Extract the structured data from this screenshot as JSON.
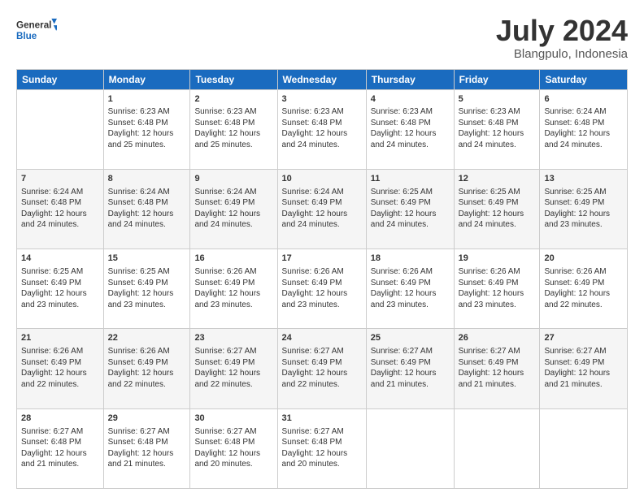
{
  "logo": {
    "line1": "General",
    "line2": "Blue"
  },
  "title": "July 2024",
  "subtitle": "Blangpulo, Indonesia",
  "days_header": [
    "Sunday",
    "Monday",
    "Tuesday",
    "Wednesday",
    "Thursday",
    "Friday",
    "Saturday"
  ],
  "weeks": [
    [
      {
        "day": "",
        "info": ""
      },
      {
        "day": "1",
        "info": "Sunrise: 6:23 AM\nSunset: 6:48 PM\nDaylight: 12 hours\nand 25 minutes."
      },
      {
        "day": "2",
        "info": "Sunrise: 6:23 AM\nSunset: 6:48 PM\nDaylight: 12 hours\nand 25 minutes."
      },
      {
        "day": "3",
        "info": "Sunrise: 6:23 AM\nSunset: 6:48 PM\nDaylight: 12 hours\nand 24 minutes."
      },
      {
        "day": "4",
        "info": "Sunrise: 6:23 AM\nSunset: 6:48 PM\nDaylight: 12 hours\nand 24 minutes."
      },
      {
        "day": "5",
        "info": "Sunrise: 6:23 AM\nSunset: 6:48 PM\nDaylight: 12 hours\nand 24 minutes."
      },
      {
        "day": "6",
        "info": "Sunrise: 6:24 AM\nSunset: 6:48 PM\nDaylight: 12 hours\nand 24 minutes."
      }
    ],
    [
      {
        "day": "7",
        "info": ""
      },
      {
        "day": "8",
        "info": "Sunrise: 6:24 AM\nSunset: 6:48 PM\nDaylight: 12 hours\nand 24 minutes."
      },
      {
        "day": "9",
        "info": "Sunrise: 6:24 AM\nSunset: 6:49 PM\nDaylight: 12 hours\nand 24 minutes."
      },
      {
        "day": "10",
        "info": "Sunrise: 6:24 AM\nSunset: 6:49 PM\nDaylight: 12 hours\nand 24 minutes."
      },
      {
        "day": "11",
        "info": "Sunrise: 6:25 AM\nSunset: 6:49 PM\nDaylight: 12 hours\nand 24 minutes."
      },
      {
        "day": "12",
        "info": "Sunrise: 6:25 AM\nSunset: 6:49 PM\nDaylight: 12 hours\nand 24 minutes."
      },
      {
        "day": "13",
        "info": "Sunrise: 6:25 AM\nSunset: 6:49 PM\nDaylight: 12 hours\nand 23 minutes."
      }
    ],
    [
      {
        "day": "14",
        "info": ""
      },
      {
        "day": "15",
        "info": "Sunrise: 6:25 AM\nSunset: 6:49 PM\nDaylight: 12 hours\nand 23 minutes."
      },
      {
        "day": "16",
        "info": "Sunrise: 6:26 AM\nSunset: 6:49 PM\nDaylight: 12 hours\nand 23 minutes."
      },
      {
        "day": "17",
        "info": "Sunrise: 6:26 AM\nSunset: 6:49 PM\nDaylight: 12 hours\nand 23 minutes."
      },
      {
        "day": "18",
        "info": "Sunrise: 6:26 AM\nSunset: 6:49 PM\nDaylight: 12 hours\nand 23 minutes."
      },
      {
        "day": "19",
        "info": "Sunrise: 6:26 AM\nSunset: 6:49 PM\nDaylight: 12 hours\nand 23 minutes."
      },
      {
        "day": "20",
        "info": "Sunrise: 6:26 AM\nSunset: 6:49 PM\nDaylight: 12 hours\nand 22 minutes."
      }
    ],
    [
      {
        "day": "21",
        "info": ""
      },
      {
        "day": "22",
        "info": "Sunrise: 6:26 AM\nSunset: 6:49 PM\nDaylight: 12 hours\nand 22 minutes."
      },
      {
        "day": "23",
        "info": "Sunrise: 6:27 AM\nSunset: 6:49 PM\nDaylight: 12 hours\nand 22 minutes."
      },
      {
        "day": "24",
        "info": "Sunrise: 6:27 AM\nSunset: 6:49 PM\nDaylight: 12 hours\nand 22 minutes."
      },
      {
        "day": "25",
        "info": "Sunrise: 6:27 AM\nSunset: 6:49 PM\nDaylight: 12 hours\nand 21 minutes."
      },
      {
        "day": "26",
        "info": "Sunrise: 6:27 AM\nSunset: 6:49 PM\nDaylight: 12 hours\nand 21 minutes."
      },
      {
        "day": "27",
        "info": "Sunrise: 6:27 AM\nSunset: 6:49 PM\nDaylight: 12 hours\nand 21 minutes."
      }
    ],
    [
      {
        "day": "28",
        "info": "Sunrise: 6:27 AM\nSunset: 6:48 PM\nDaylight: 12 hours\nand 21 minutes."
      },
      {
        "day": "29",
        "info": "Sunrise: 6:27 AM\nSunset: 6:48 PM\nDaylight: 12 hours\nand 21 minutes."
      },
      {
        "day": "30",
        "info": "Sunrise: 6:27 AM\nSunset: 6:48 PM\nDaylight: 12 hours\nand 20 minutes."
      },
      {
        "day": "31",
        "info": "Sunrise: 6:27 AM\nSunset: 6:48 PM\nDaylight: 12 hours\nand 20 minutes."
      },
      {
        "day": "",
        "info": ""
      },
      {
        "day": "",
        "info": ""
      },
      {
        "day": "",
        "info": ""
      }
    ]
  ],
  "week7_sunday_info": "Sunrise: 6:24 AM\nSunset: 6:48 PM\nDaylight: 12 hours\nand 24 minutes.",
  "week14_sunday_info": "Sunrise: 6:25 AM\nSunset: 6:49 PM\nDaylight: 12 hours\nand 23 minutes.",
  "week21_sunday_info": "Sunrise: 6:26 AM\nSunset: 6:49 PM\nDaylight: 12 hours\nand 22 minutes."
}
